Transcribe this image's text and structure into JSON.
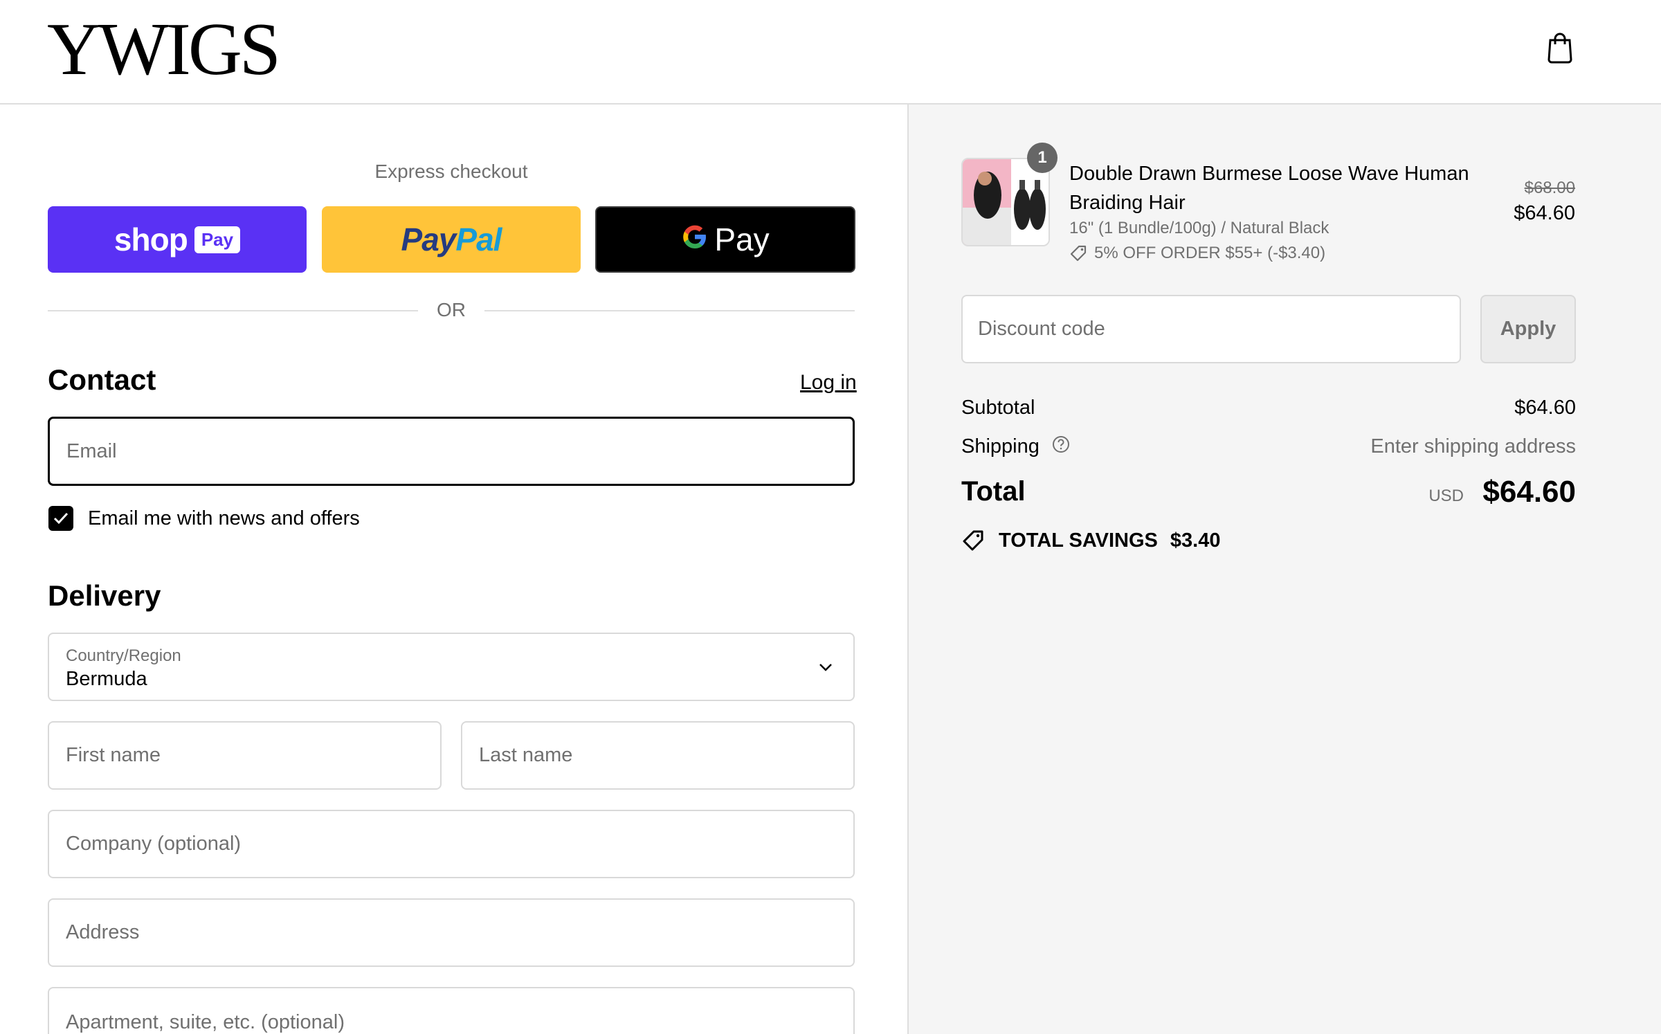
{
  "brand": {
    "logo_text": "YWIGS"
  },
  "header": {
    "cart_icon": "shopping-bag-icon"
  },
  "express": {
    "title": "Express checkout",
    "shop_pay": {
      "word": "shop",
      "tag": "Pay",
      "color": "#5a31f4"
    },
    "paypal": {
      "part1": "Pay",
      "part2": "Pal",
      "color": "#ffc439"
    },
    "gpay": {
      "g": "G",
      "word": "Pay",
      "color": "#000000"
    },
    "or_text": "OR"
  },
  "contact": {
    "title": "Contact",
    "login_label": "Log in",
    "email_placeholder": "Email",
    "newsletter_label": "Email me with news and offers",
    "newsletter_checked": true
  },
  "delivery": {
    "title": "Delivery",
    "country_label": "Country/Region",
    "country_value": "Bermuda",
    "first_name_placeholder": "First name",
    "last_name_placeholder": "Last name",
    "company_placeholder": "Company (optional)",
    "address_placeholder": "Address",
    "apartment_placeholder": "Apartment, suite, etc. (optional)"
  },
  "order": {
    "item": {
      "quantity": "1",
      "title": "Double Drawn Burmese Loose Wave Human Braiding Hair",
      "variant": "16\" (1 Bundle/100g) / Natural Black",
      "discount": "5% OFF ORDER $55+ (-$3.40)",
      "original_price": "$68.00",
      "price": "$64.60"
    },
    "discount_placeholder": "Discount code",
    "apply_label": "Apply",
    "subtotal_label": "Subtotal",
    "subtotal_value": "$64.60",
    "shipping_label": "Shipping",
    "shipping_value": "Enter shipping address",
    "total_label": "Total",
    "total_currency": "USD",
    "total_value": "$64.60",
    "savings_label": "TOTAL SAVINGS",
    "savings_value": "$3.40"
  },
  "colors": {
    "accent": "#000000",
    "muted": "#707070",
    "summary_bg": "#f5f5f5",
    "border": "#d9d9d9"
  }
}
